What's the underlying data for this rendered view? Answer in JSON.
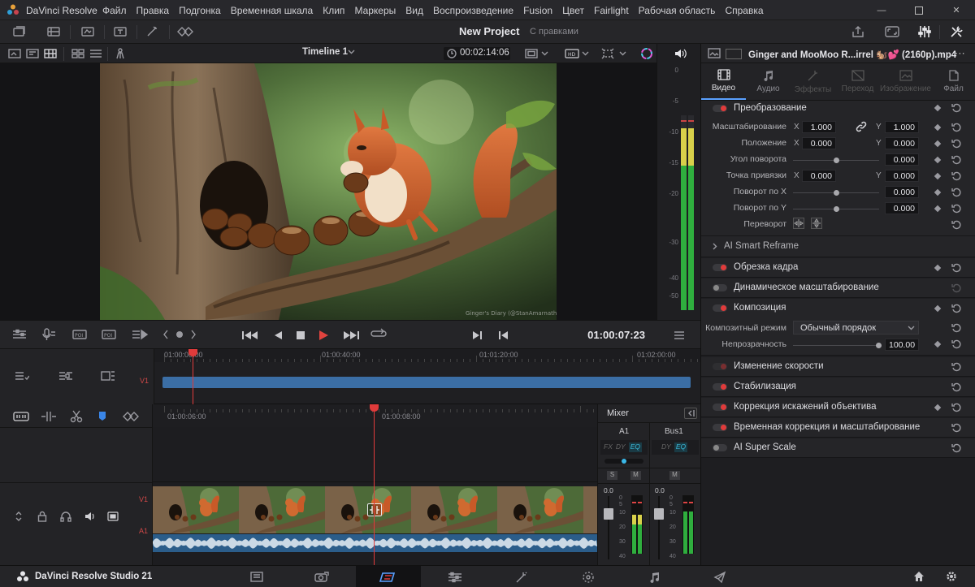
{
  "app": {
    "title": "DaVinci Resolve",
    "menus": [
      "Файл",
      "Правка",
      "Подгонка",
      "Временная шкала",
      "Клип",
      "Маркеры",
      "Вид",
      "Воспроизведение",
      "Fusion",
      "Цвет",
      "Fairlight",
      "Рабочая область",
      "Справка"
    ],
    "project_name": "New Project",
    "project_state": "С правками",
    "brand": "DaVinci Resolve Studio 21"
  },
  "viewer": {
    "timeline_name": "Timeline 1",
    "source_timecode": "00:02:14:06",
    "watermark": "Ginger's Diary (@StanAmarnath)",
    "meter_scale": [
      "0",
      "-5",
      "-10",
      "-15",
      "-20",
      "-30",
      "-40",
      "-50"
    ]
  },
  "transport": {
    "timecode": "01:00:07:23"
  },
  "timeline": {
    "upper_ruler": [
      "01:00:00:00",
      "01:00:40:00",
      "01:01:20:00",
      "01:02:00:00"
    ],
    "upper_track": "V1",
    "lower_ruler": [
      "01:00:06:00",
      "01:00:08:00"
    ],
    "video_track": "V1",
    "audio_track": "A1"
  },
  "mixer": {
    "title": "Mixer",
    "channels": [
      "A1",
      "Bus1"
    ],
    "fx_labels": [
      "FX",
      "DY",
      "EQ"
    ],
    "bus_labels": [
      "DY",
      "EQ"
    ],
    "solo": "S",
    "mute": "M",
    "level": "0.0",
    "scale": [
      "0",
      "5",
      "10",
      "20",
      "30",
      "40"
    ]
  },
  "inspector": {
    "clip_name": "Ginger and MooMoo R...irrel 🐿️💕 (2160p).mp4",
    "tabs": [
      {
        "label": "Видео",
        "state": "active"
      },
      {
        "label": "Аудио",
        "state": "normal"
      },
      {
        "label": "Эффекты",
        "state": "dim"
      },
      {
        "label": "Переход",
        "state": "dim"
      },
      {
        "label": "Изображение",
        "state": "dim"
      },
      {
        "label": "Файл",
        "state": "normal"
      }
    ],
    "transform": {
      "title": "Преобразование",
      "zoom_label": "Масштабирование",
      "zoom_x": "1.000",
      "zoom_y": "1.000",
      "position_label": "Положение",
      "pos_x": "0.000",
      "pos_y": "0.000",
      "rotation_label": "Угол поворота",
      "rotation": "0.000",
      "anchor_label": "Точка привязки",
      "anchor_x": "0.000",
      "anchor_y": "0.000",
      "pitch_label": "Поворот по X",
      "pitch": "0.000",
      "yaw_label": "Поворот по Y",
      "yaw": "0.000",
      "flip_label": "Переворот",
      "x": "X",
      "y": "Y"
    },
    "smart_reframe": "AI Smart Reframe",
    "crop": "Обрезка кадра",
    "dynamic_zoom": "Динамическое масштабирование",
    "composite": {
      "title": "Композиция",
      "mode_label": "Композитный режим",
      "mode_value": "Обычный порядок",
      "opacity_label": "Непрозрачность",
      "opacity": "100.00"
    },
    "speed": "Изменение скорости",
    "stabilization": "Стабилизация",
    "lens": "Коррекция искажений объектива",
    "retime": "Временная коррекция и масштабирование",
    "superscale": "AI Super Scale"
  },
  "colors": {
    "accent": "#5aa0ff",
    "playhead": "#e03b3b",
    "clip_blue": "#3b6ea5"
  }
}
